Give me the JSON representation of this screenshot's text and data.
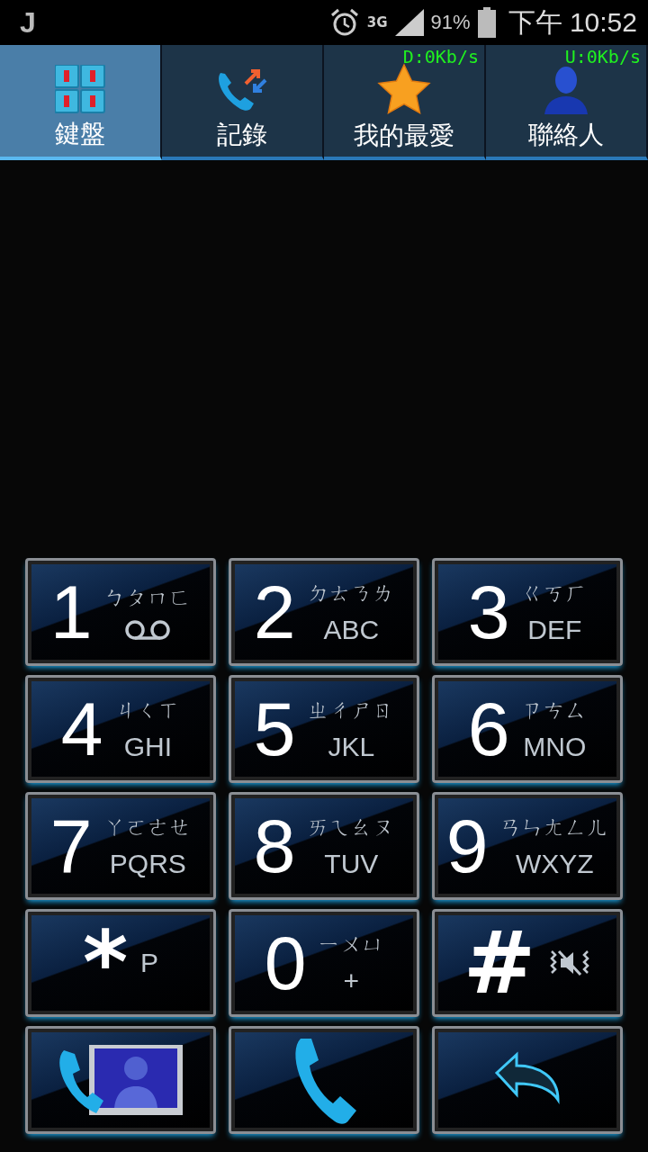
{
  "status_bar": {
    "notification": "J",
    "network": "3G",
    "battery": "91%",
    "time": "下午 10:52"
  },
  "net_speed": {
    "download": "D:0Kb/s",
    "upload": "U:0Kb/s"
  },
  "tabs": [
    {
      "label": "鍵盤",
      "kind": "keypad",
      "selected": true
    },
    {
      "label": "記錄",
      "kind": "log",
      "selected": false
    },
    {
      "label": "我的最愛",
      "kind": "favorites",
      "selected": false
    },
    {
      "label": "聯絡人",
      "kind": "contacts",
      "selected": false
    }
  ],
  "keys": [
    {
      "digit": "1",
      "zhuyin": "ㄅㄆㄇㄈ",
      "kind": "voicemail"
    },
    {
      "digit": "2",
      "zhuyin": "ㄉㄊㄋㄌ",
      "letters": "ABC",
      "kind": "letters"
    },
    {
      "digit": "3",
      "zhuyin": "ㄍㄎㄏ",
      "letters": "DEF",
      "kind": "letters"
    },
    {
      "digit": "4",
      "zhuyin": "ㄐㄑㄒ",
      "letters": "GHI",
      "kind": "letters"
    },
    {
      "digit": "5",
      "zhuyin": "ㄓㄔㄕㄖ",
      "letters": "JKL",
      "kind": "letters"
    },
    {
      "digit": "6",
      "zhuyin": "ㄗㄘㄙ",
      "letters": "MNO",
      "kind": "letters"
    },
    {
      "digit": "7",
      "zhuyin": "ㄚㄛㄜㄝ",
      "letters": "PQRS",
      "kind": "letters"
    },
    {
      "digit": "8",
      "zhuyin": "ㄞㄟㄠㄡ",
      "letters": "TUV",
      "kind": "letters"
    },
    {
      "digit": "9",
      "zhuyin": "ㄢㄣㄤㄥㄦ",
      "letters": "WXYZ",
      "kind": "letters"
    },
    {
      "digit": "*",
      "letters": "P",
      "kind": "letters"
    },
    {
      "digit": "0",
      "zhuyin": "ㄧㄨㄩ",
      "letters": "+",
      "kind": "letters"
    },
    {
      "digit": "#",
      "kind": "mute"
    }
  ],
  "actions": [
    {
      "kind": "video-call"
    },
    {
      "kind": "call"
    },
    {
      "kind": "back"
    }
  ]
}
